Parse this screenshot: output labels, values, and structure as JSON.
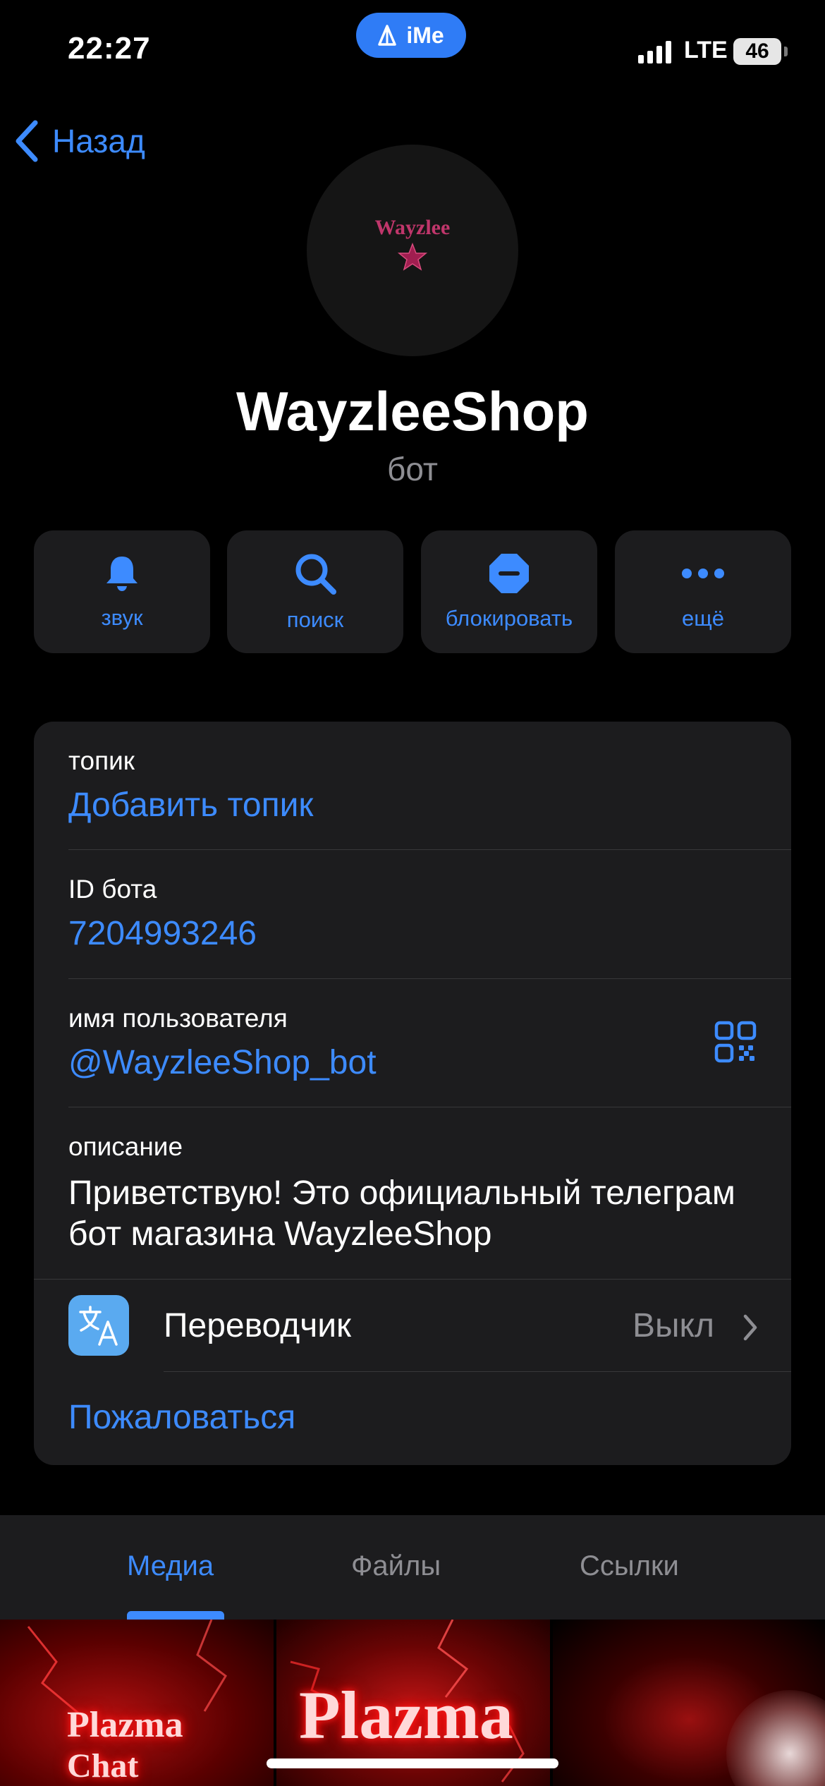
{
  "status_bar": {
    "time": "22:27",
    "ime_badge": "iMe",
    "network": "LTE",
    "battery": "46"
  },
  "nav": {
    "back_label": "Назад"
  },
  "profile": {
    "avatar_text": "Wayzlee",
    "name": "WayzleeShop",
    "subtitle": "бот"
  },
  "actions": [
    {
      "label": "звук",
      "icon": "bell-icon"
    },
    {
      "label": "поиск",
      "icon": "search-icon"
    },
    {
      "label": "блокировать",
      "icon": "block-icon"
    },
    {
      "label": "ещё",
      "icon": "more-icon"
    }
  ],
  "info": {
    "topic_label": "топик",
    "topic_value": "Добавить топик",
    "bot_id_label": "ID бота",
    "bot_id_value": "7204993246",
    "username_label": "имя пользователя",
    "username_value": "@WayzleeShop_bot",
    "description_label": "описание",
    "description_value": "Приветствую! Это официальный телеграм бот магазина WayzleeShop",
    "translator_label": "Переводчик",
    "translator_value": "Выкл",
    "report_label": "Пожаловаться"
  },
  "tabs": [
    {
      "label": "Медиа",
      "active": true
    },
    {
      "label": "Файлы",
      "active": false
    },
    {
      "label": "Ссылки",
      "active": false
    }
  ],
  "media_thumbs": [
    {
      "text_line1": "Plazma",
      "text_line2": "Chat"
    },
    {
      "text_line1": "Plazma"
    },
    {}
  ],
  "colors": {
    "accent": "#3d8bff",
    "background": "#000000",
    "card": "#1c1c1e",
    "secondary_text": "#8e8e93"
  }
}
